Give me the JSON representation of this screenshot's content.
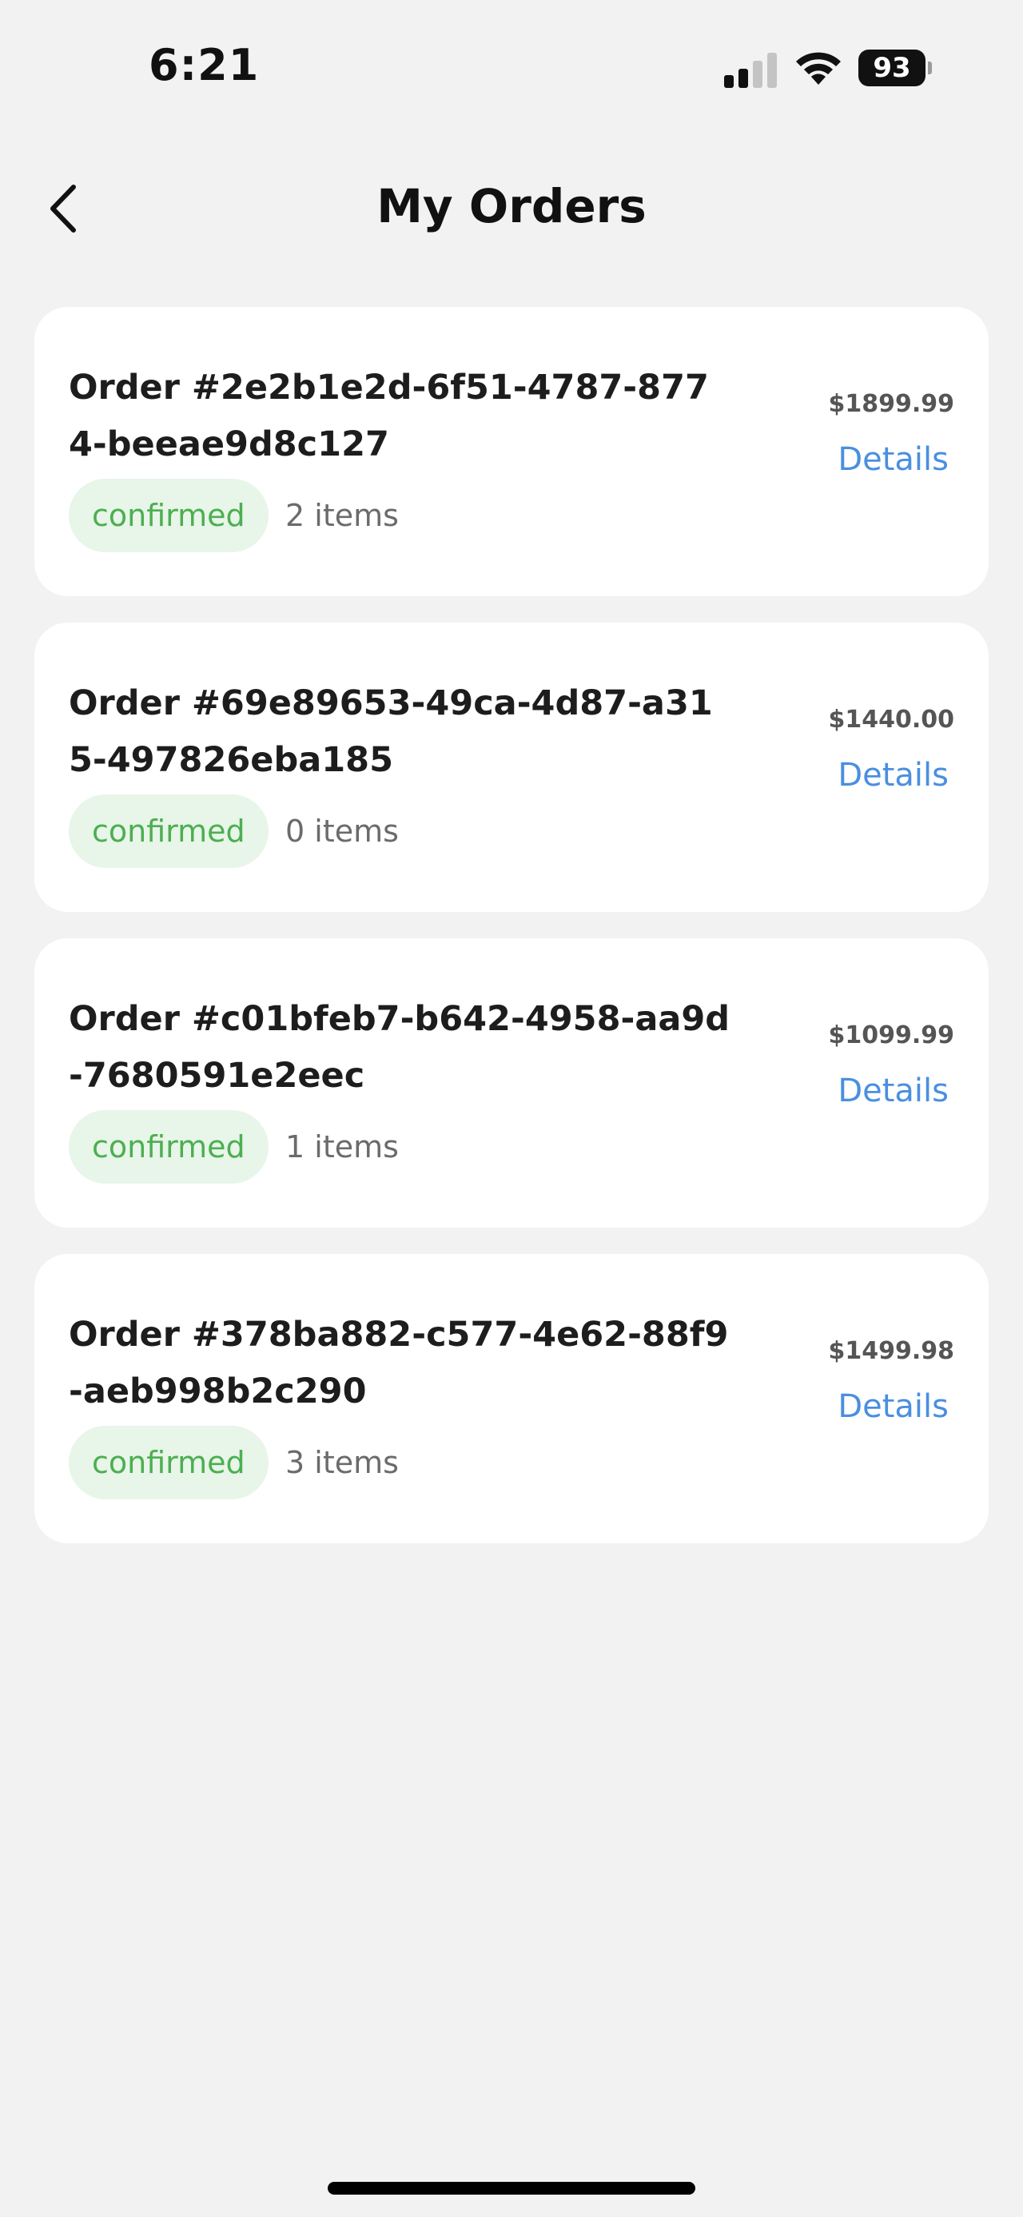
{
  "status_bar": {
    "time": "6:21",
    "battery_level": "93",
    "icons": [
      "signal-icon",
      "wifi-icon",
      "battery-icon"
    ]
  },
  "header": {
    "title": "My Orders",
    "back_icon": "chevron-left-icon"
  },
  "colors": {
    "background": "#f2f2f2",
    "card": "#ffffff",
    "status_green": "#4caf50",
    "status_green_bg": "#e8f5e9",
    "link_blue": "#4a8fe0"
  },
  "orders": [
    {
      "title": "Order #2e2b1e2d-6f51-4787-8774-beeae9d8c127",
      "status": "confirmed",
      "items": "2 items",
      "price": "$1899.99",
      "details_label": "Details"
    },
    {
      "title": "Order #69e89653-49ca-4d87-a315-497826eba185",
      "status": "confirmed",
      "items": "0 items",
      "price": "$1440.00",
      "details_label": "Details"
    },
    {
      "title": "Order #c01bfeb7-b642-4958-aa9d-7680591e2eec",
      "status": "confirmed",
      "items": "1 items",
      "price": "$1099.99",
      "details_label": "Details"
    },
    {
      "title": "Order #378ba882-c577-4e62-88f9-aeb998b2c290",
      "status": "confirmed",
      "items": "3 items",
      "price": "$1499.98",
      "details_label": "Details"
    }
  ]
}
